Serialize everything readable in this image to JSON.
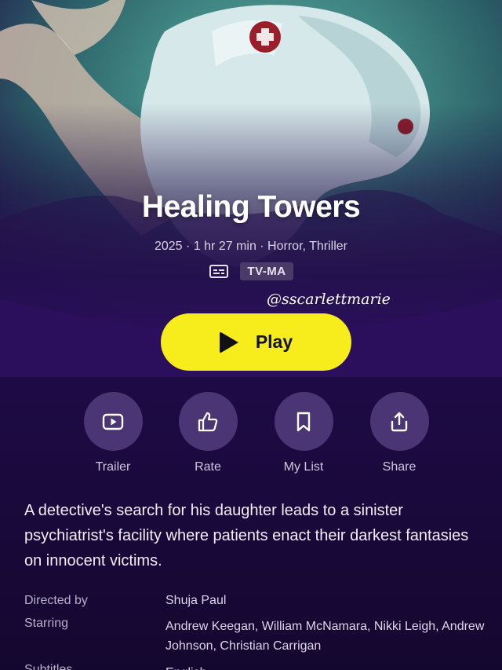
{
  "title": "Healing Towers",
  "meta_line": "2025 · 1 hr 27 min · Horror, Thriller",
  "rating": "TV-MA",
  "watermark": "@sscarlettmarie",
  "play_label": "Play",
  "actions": [
    {
      "label": "Trailer",
      "icon": "play-square-icon"
    },
    {
      "label": "Rate",
      "icon": "thumbs-up-icon"
    },
    {
      "label": "My List",
      "icon": "bookmark-icon"
    },
    {
      "label": "Share",
      "icon": "share-icon"
    }
  ],
  "description": "A detective's search for his daughter leads to a sinister psychiatrist's facility where patients enact their darkest fantasies on innocent victims.",
  "details": [
    {
      "key": "Directed by",
      "value": "Shuja Paul"
    },
    {
      "key": "Starring",
      "value": "Andrew Keegan, William McNamara, Nikki Leigh, Andrew Johnson, Christian Carrigan"
    },
    {
      "key": "Subtitles",
      "value": "English"
    }
  ],
  "colors": {
    "play_button": "#f7ec1c",
    "background": "#210b4b",
    "action_circle": "#4b3575"
  }
}
